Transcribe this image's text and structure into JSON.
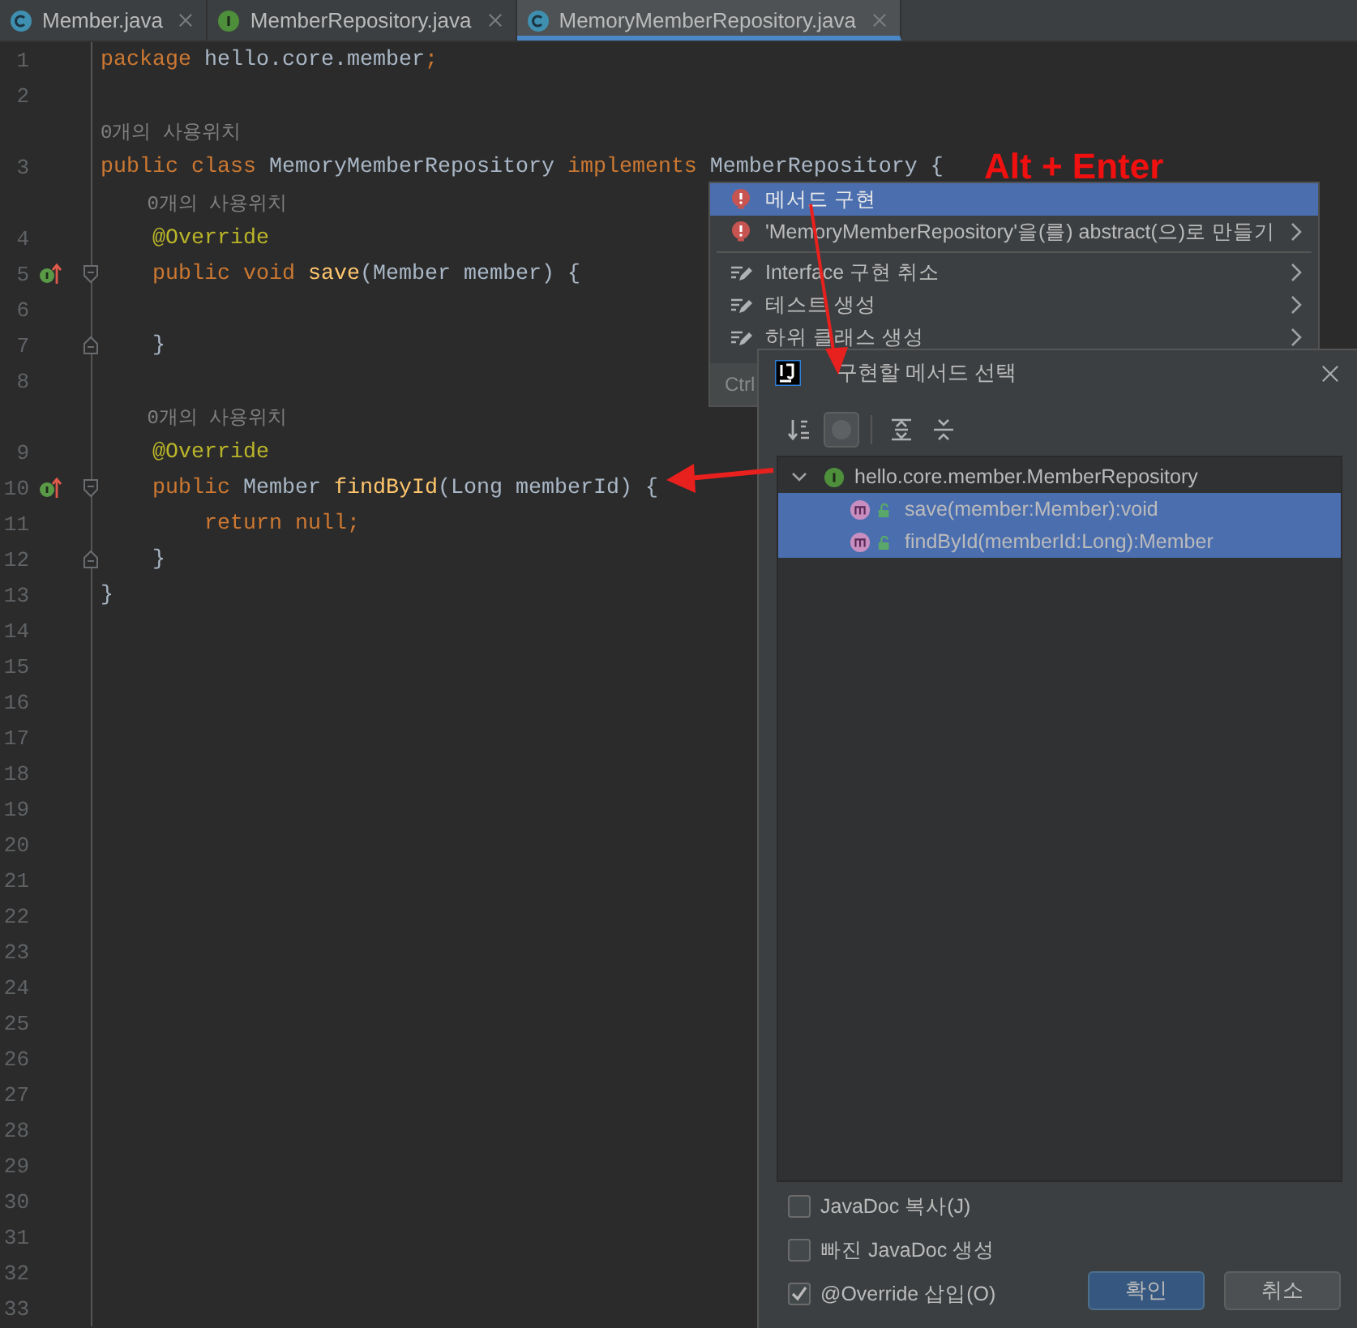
{
  "tabs": [
    {
      "label": "Member.java",
      "kind": "class",
      "selected": false
    },
    {
      "label": "MemberRepository.java",
      "kind": "interface",
      "selected": false
    },
    {
      "label": "MemoryMemberRepository.java",
      "kind": "class",
      "selected": true
    }
  ],
  "editor": {
    "rows": [
      {
        "number": "1",
        "tokens": [
          {
            "kind": "keyword",
            "text": "package"
          },
          {
            "kind": "plain",
            "text": " hello.core.member"
          },
          {
            "kind": "keyword",
            "text": ";"
          }
        ]
      },
      {
        "number": "2"
      },
      {
        "tokens": [
          {
            "kind": "hint",
            "text": "0개의 사용위치"
          }
        ]
      },
      {
        "number": "3",
        "tokens": [
          {
            "kind": "keyword",
            "text": "public class"
          },
          {
            "kind": "plain",
            "text": " MemoryMemberRepository "
          },
          {
            "kind": "keyword",
            "text": "implements"
          },
          {
            "kind": "plain",
            "text": " MemberRepository {"
          }
        ]
      },
      {
        "tokens": [
          {
            "kind": "hint",
            "text": "    0개의 사용위치"
          }
        ]
      },
      {
        "number": "4",
        "tokens": [
          {
            "kind": "annotation",
            "text": "    @Override"
          }
        ]
      },
      {
        "number": "5",
        "implements_marker": true,
        "fold_start": true,
        "tokens": [
          {
            "kind": "keyword",
            "text": "    public void "
          },
          {
            "kind": "method",
            "text": "save"
          },
          {
            "kind": "plain",
            "text": "(Member member) {"
          }
        ]
      },
      {
        "number": "6"
      },
      {
        "number": "7",
        "fold_end": true,
        "tokens": [
          {
            "kind": "plain",
            "text": "    }"
          }
        ]
      },
      {
        "number": "8"
      },
      {
        "tokens": [
          {
            "kind": "hint",
            "text": "    0개의 사용위치"
          }
        ]
      },
      {
        "number": "9",
        "tokens": [
          {
            "kind": "annotation",
            "text": "    @Override"
          }
        ]
      },
      {
        "number": "10",
        "implements_marker": true,
        "fold_start": true,
        "tokens": [
          {
            "kind": "keyword",
            "text": "    public"
          },
          {
            "kind": "plain",
            "text": " Member "
          },
          {
            "kind": "method",
            "text": "findById"
          },
          {
            "kind": "plain",
            "text": "(Long memberId) {"
          }
        ]
      },
      {
        "number": "11",
        "tokens": [
          {
            "kind": "keyword",
            "text": "        return null;"
          }
        ]
      },
      {
        "number": "12",
        "fold_end": true,
        "tokens": [
          {
            "kind": "plain",
            "text": "    }"
          }
        ]
      },
      {
        "number": "13",
        "tokens": [
          {
            "kind": "plain",
            "text": "}"
          }
        ]
      },
      {
        "number": "14"
      },
      {
        "number": "15"
      },
      {
        "number": "16"
      },
      {
        "number": "17"
      },
      {
        "number": "18"
      },
      {
        "number": "19"
      },
      {
        "number": "20"
      },
      {
        "number": "21"
      },
      {
        "number": "22"
      },
      {
        "number": "23"
      },
      {
        "number": "24"
      },
      {
        "number": "25"
      },
      {
        "number": "26"
      },
      {
        "number": "27"
      },
      {
        "number": "28"
      },
      {
        "number": "29"
      },
      {
        "number": "30"
      },
      {
        "number": "31"
      },
      {
        "number": "32"
      },
      {
        "number": "33"
      }
    ]
  },
  "intention_menu": {
    "items": [
      {
        "text": "메서드 구현",
        "kind": "error",
        "submenu": false,
        "selected": true
      },
      {
        "text": "'MemoryMemberRepository'을(를) abstract(으)로 만들기",
        "kind": "error",
        "submenu": true,
        "selected": false
      },
      {
        "text": "Interface 구현 취소",
        "kind": "edit",
        "submenu": true,
        "selected": false,
        "separator_before": true
      },
      {
        "text": "테스트 생성",
        "kind": "edit",
        "submenu": true,
        "selected": false
      },
      {
        "text": "하위 클래스 생성",
        "kind": "edit",
        "submenu": true,
        "selected": false
      }
    ],
    "footer": "Ctrl"
  },
  "dialog": {
    "title": "구현할 메서드 선택",
    "toolbar": [
      {
        "kind": "sort",
        "on": false
      },
      {
        "kind": "toggle",
        "on": true
      },
      {
        "kind": "expand",
        "on": false
      },
      {
        "kind": "collapse",
        "on": false
      }
    ],
    "tree": {
      "label": "hello.core.member.MemberRepository",
      "expanded": true,
      "selected": false,
      "children": [
        {
          "label": "save(member:Member):void",
          "selected": true
        },
        {
          "label": "findById(memberId:Long):Member",
          "selected": true
        }
      ]
    },
    "options": [
      {
        "label": "JavaDoc 복사(J)",
        "checked": false
      },
      {
        "label": "빠진 JavaDoc 생성",
        "checked": false
      },
      {
        "label": "@Override 삽입(O)",
        "checked": true
      }
    ],
    "buttons": [
      {
        "label": "확인",
        "kind": "default"
      },
      {
        "label": "취소",
        "kind": "normal"
      }
    ]
  },
  "annotation": {
    "shortcut": "Alt + Enter"
  }
}
